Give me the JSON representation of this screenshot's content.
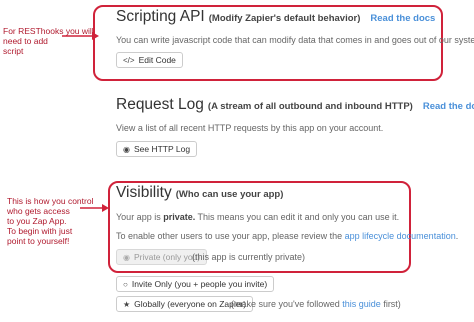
{
  "annotations": {
    "top_note": [
      "For RESThooks you will",
      "need to add",
      "script"
    ],
    "bottom_note": [
      "This is how you control",
      "who gets access",
      "to you Zap App.",
      "To begin with just",
      "point to yourself!"
    ]
  },
  "scripting": {
    "title": "Scripting API",
    "subtitle": "(Modify Zapier's default behavior)",
    "docs_link": "Read the docs",
    "description": "You can write javascript code that can modify data that comes in and goes out of our system.",
    "button_label": "Edit Code"
  },
  "request_log": {
    "title": "Request Log",
    "subtitle": "(A stream of all outbound and inbound HTTP)",
    "docs_link": "Read the docs",
    "description": "View a list of all recent HTTP requests by this app on your account.",
    "button_label": "See HTTP Log"
  },
  "visibility": {
    "title": "Visibility",
    "subtitle": "(Who can use your app)",
    "status_prefix": "Your app is ",
    "status_value": "private.",
    "status_suffix": " This means you can edit it and only you can use it.",
    "enable_text": "To enable other users to use your app, please review the ",
    "enable_link": "app lifecycle documentation",
    "enable_end": ".",
    "private_button": "Private (only you)",
    "private_note": "(this app is currently private)",
    "invite_button": "Invite Only (you + people you invite)",
    "global_button": "Globally (everyone on Zapier)",
    "global_note_prefix": "(make sure you've followed ",
    "global_note_link": "this guide",
    "global_note_suffix": " first)"
  },
  "colors": {
    "highlight": "#d0223a",
    "link": "#4a90d9"
  }
}
